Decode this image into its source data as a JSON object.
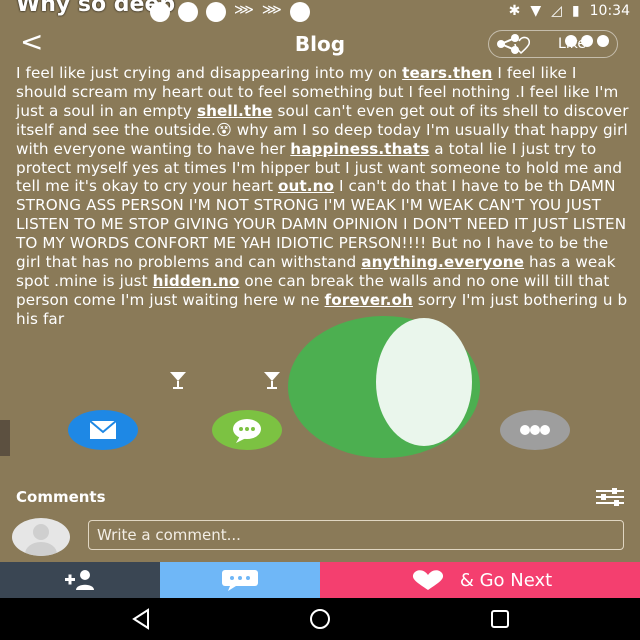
{
  "status_bar": {
    "overlay_text": "Why so deep",
    "time": "10:34"
  },
  "app_bar": {
    "back_label": "<",
    "title": "Blog",
    "like_label": "Like"
  },
  "post": {
    "segments": [
      {
        "t": "I feel like just crying and disappearing into my on ",
        "link": false
      },
      {
        "t": "tears.then",
        "link": true
      },
      {
        "t": " I feel like I should scream my heart out to feel something but I feel nothing .I feel like I'm just a soul in an empty ",
        "link": false
      },
      {
        "t": "shell.the",
        "link": true
      },
      {
        "t": " soul can't even get out of its shell to  discover itself and see the outside.",
        "link": false
      },
      {
        "t": "😵",
        "link": false
      },
      {
        "t": " why am I so deep today I'm usually that happy girl with everyone wanting to have her ",
        "link": false
      },
      {
        "t": "happiness.thats",
        "link": true
      },
      {
        "t": " a total lie I just try to protect myself yes at times I'm hipper but I just want someone to hold me and tell me it's okay to cry your heart ",
        "link": false
      },
      {
        "t": "out.no",
        "link": true
      },
      {
        "t": " I can't do that I have to be th DAMN STRONG ASS PERSON I'M NOT STRONG I'M WEAK I'M WEAK CAN'T YOU JUST LISTEN TO ME STOP GIVING YOUR DAMN OPINION I DON'T NEED IT JUST LISTEN TO MY WORDS CONFORT ME YAH IDIOTIC PERSON!!!! But no I have to be the girl  that has no problems and can withstand ",
        "link": false
      },
      {
        "t": "anything.everyone",
        "link": true
      },
      {
        "t": " has a weak spot .mine is just ",
        "link": false
      },
      {
        "t": "hidden.no",
        "link": true
      },
      {
        "t": " one can break the walls and no one will till that person come I'm just waiting here w",
        "link": false
      },
      {
        "t": "                 ",
        "link": false
      },
      {
        "t": "ne ",
        "link": false
      },
      {
        "t": "forever.oh",
        "link": true
      },
      {
        "t": " sorry I'm just bothering u b",
        "link": false
      },
      {
        "t": "                        ",
        "link": false
      },
      {
        "t": "his far",
        "link": false
      }
    ]
  },
  "share_row": {
    "items": [
      {
        "name": "email-share-button",
        "color": "#1e88e5"
      },
      {
        "name": "message-share-button",
        "color": "#7cc242"
      },
      {
        "name": "more-share-button",
        "color": "#9e9e9e"
      }
    ]
  },
  "comments": {
    "title": "Comments",
    "input_placeholder": "Write a comment..."
  },
  "bottom_bar": {
    "follow_color": "#3a4653",
    "chat_color": "#6fb7f7",
    "next_label": "& Go Next",
    "next_color": "#f43f6f"
  }
}
